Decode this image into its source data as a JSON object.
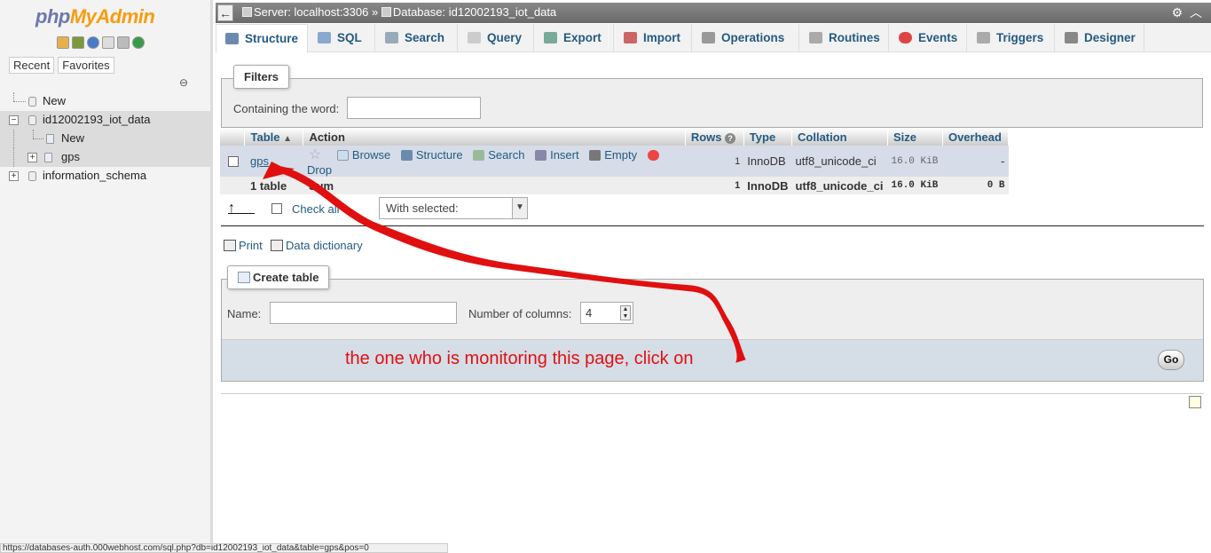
{
  "nav": {
    "logo_php": "php",
    "logo_myadmin": "MyAdmin",
    "tabs": [
      "Recent",
      "Favorites"
    ],
    "tree": [
      {
        "label": "New"
      },
      {
        "label": "id12002193_iot_data"
      },
      {
        "label": "New"
      },
      {
        "label": "gps"
      },
      {
        "label": "information_schema"
      }
    ]
  },
  "breadcrumb": {
    "server": "Server: localhost:3306",
    "separator": "»",
    "database": "Database: id12002193_iot_data"
  },
  "tabs": [
    {
      "label": "Structure",
      "icon": "structure-icon"
    },
    {
      "label": "SQL",
      "icon": "sql-icon"
    },
    {
      "label": "Search",
      "icon": "search-icon"
    },
    {
      "label": "Query",
      "icon": "query-icon"
    },
    {
      "label": "Export",
      "icon": "export-icon"
    },
    {
      "label": "Import",
      "icon": "import-icon"
    },
    {
      "label": "Operations",
      "icon": "wrench-icon"
    },
    {
      "label": "Routines",
      "icon": "routines-icon"
    },
    {
      "label": "Events",
      "icon": "clock-icon"
    },
    {
      "label": "Triggers",
      "icon": "triggers-icon"
    },
    {
      "label": "Designer",
      "icon": "designer-icon"
    }
  ],
  "filters": {
    "legend": "Filters",
    "containing_label": "Containing the word:",
    "containing_value": ""
  },
  "table": {
    "headers": {
      "table": "Table",
      "action": "Action",
      "rows": "Rows",
      "type": "Type",
      "collation": "Collation",
      "size": "Size",
      "overhead": "Overhead"
    },
    "rows": [
      {
        "name": "gps",
        "actions": [
          "Browse",
          "Structure",
          "Search",
          "Insert",
          "Empty",
          "Drop"
        ],
        "rows": "1",
        "type": "InnoDB",
        "collation": "utf8_unicode_ci",
        "size": "16.0 KiB",
        "overhead": "-"
      }
    ],
    "sum": {
      "tables": "1 table",
      "label": "Sum",
      "rows": "1",
      "type": "InnoDB",
      "collation": "utf8_unicode_ci",
      "size": "16.0 KiB",
      "overhead": "0 B"
    }
  },
  "bulk": {
    "check_all": "Check all",
    "with_selected": "With selected:"
  },
  "links": {
    "print": "Print",
    "data_dictionary": "Data dictionary"
  },
  "create": {
    "legend": "Create table",
    "name_label": "Name:",
    "name_value": "",
    "numcol_label": "Number of columns:",
    "numcol_value": "4",
    "go": "Go"
  },
  "annotation": "the one who is monitoring this page, click on",
  "statusbar": "https://databases-auth.000webhost.com/sql.php?db=id12002193_iot_data&table=gps&pos=0",
  "colors": {
    "link": "#235a81",
    "annotation": "#e01010",
    "selected_row": "#d6dde8"
  }
}
